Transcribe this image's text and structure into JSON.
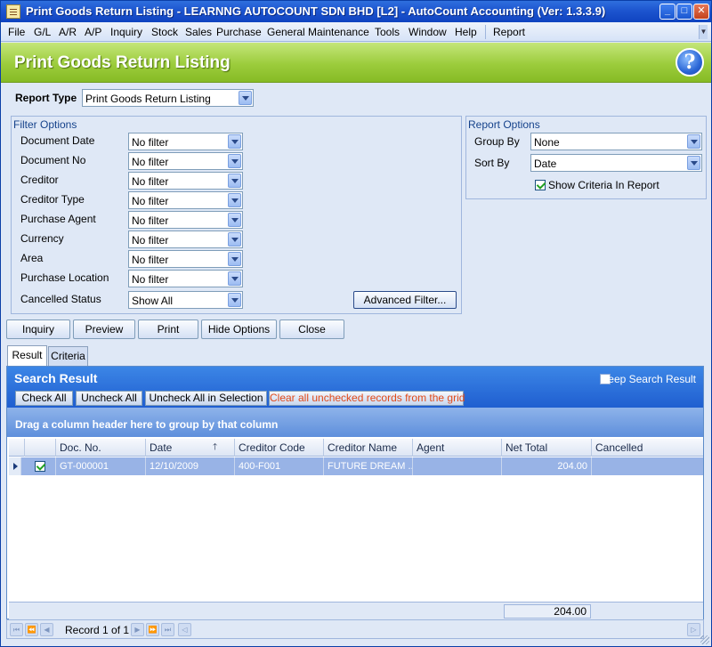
{
  "window": {
    "title": "Print Goods Return Listing - LEARNNG AUTOCOUNT SDN BHD [L2] - AutoCount Accounting (Ver: 1.3.3.9)",
    "controls": {
      "minimize": "_",
      "maximize": "□",
      "close": "✕"
    }
  },
  "menu": {
    "items": [
      "File",
      "G/L",
      "A/R",
      "A/P",
      "Inquiry",
      "Stock",
      "Sales",
      "Purchase",
      "General Maintenance",
      "Tools",
      "Window",
      "Help",
      "Report"
    ]
  },
  "header": {
    "title": "Print Goods Return Listing",
    "help_icon": "?"
  },
  "report_type": {
    "label": "Report Type",
    "value": "Print Goods Return Listing"
  },
  "filter_options": {
    "title": "Filter Options",
    "rows": [
      {
        "label": "Document Date",
        "value": "No filter"
      },
      {
        "label": "Document No",
        "value": "No filter"
      },
      {
        "label": "Creditor",
        "value": "No filter"
      },
      {
        "label": "Creditor Type",
        "value": "No filter"
      },
      {
        "label": "Purchase Agent",
        "value": "No filter"
      },
      {
        "label": "Currency",
        "value": "No filter"
      },
      {
        "label": "Area",
        "value": "No filter"
      },
      {
        "label": "Purchase Location",
        "value": "No filter"
      },
      {
        "label": "Cancelled Status",
        "value": "Show All"
      }
    ],
    "advanced_filter": "Advanced Filter..."
  },
  "report_options": {
    "title": "Report Options",
    "group_by": {
      "label": "Group By",
      "value": "None"
    },
    "sort_by": {
      "label": "Sort By",
      "value": "Date"
    },
    "show_criteria": {
      "label": "Show Criteria In Report",
      "checked": true
    }
  },
  "actions": {
    "inquiry": "Inquiry",
    "preview": "Preview",
    "print": "Print",
    "hide_options": "Hide Options",
    "close": "Close"
  },
  "tabs": {
    "result": "Result",
    "criteria": "Criteria"
  },
  "search_result": {
    "title": "Search Result",
    "keep_label": "Keep Search Result",
    "check_all": "Check All",
    "uncheck_all": "Uncheck All",
    "uncheck_selection": "Uncheck All in Selection",
    "clear_unchecked": "Clear all unchecked records from the grid"
  },
  "grid": {
    "group_hint": "Drag a column header here to group by that column",
    "columns": [
      "Doc. No.",
      "Date",
      "Creditor Code",
      "Creditor Name",
      "Agent",
      "Net Total",
      "Cancelled"
    ],
    "rows": [
      {
        "checked": true,
        "doc_no": "GT-000001",
        "date": "12/10/2009",
        "creditor_code": "400-F001",
        "creditor_name": "FUTURE DREAM ...",
        "agent": "",
        "net_total": "204.00",
        "cancelled": ""
      }
    ],
    "footer_total": "204.00"
  },
  "navigator": {
    "record_text": "Record 1 of 1"
  }
}
